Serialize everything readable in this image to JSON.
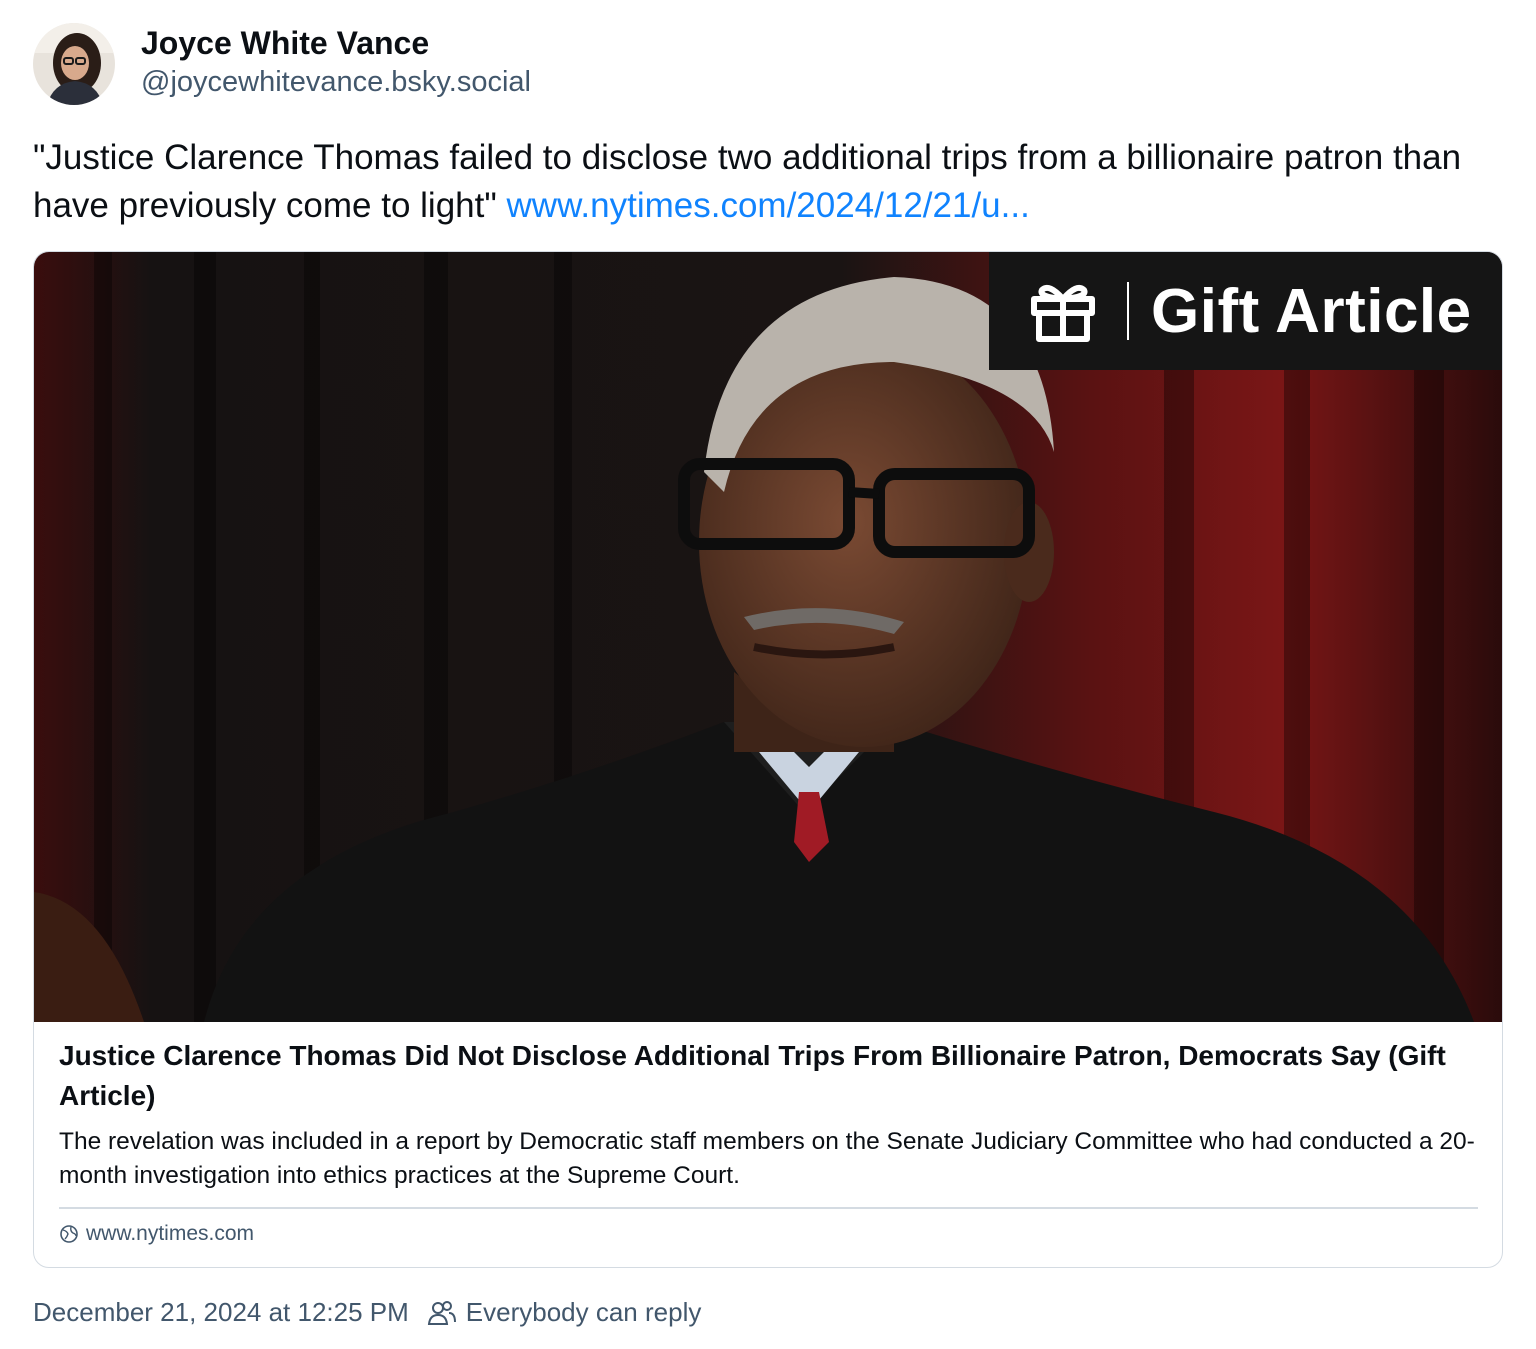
{
  "author": {
    "display_name": "Joyce White Vance",
    "handle": "@joycewhitevance.bsky.social"
  },
  "post": {
    "text": "\"Justice Clarence Thomas failed to disclose two additional trips from a billionaire patron than have previously come to light\"",
    "link_text": "www.nytimes.com/2024/12/21/u..."
  },
  "card": {
    "image_badge_label": "Gift Article",
    "title": "Justice Clarence Thomas Did Not Disclose Additional Trips From Billionaire Patron, Democrats Say (Gift Article)",
    "description": "The revelation was included in a report by Democratic staff members on the Senate Judiciary Committee who had conducted a 20-month investigation into ethics practices at the Supreme Court.",
    "domain": "www.nytimes.com"
  },
  "footer": {
    "timestamp": "December 21, 2024 at 12:25 PM",
    "reply_setting": "Everybody can reply"
  },
  "icons": {
    "gift": "gift-icon",
    "globe": "globe-icon",
    "people": "people-icon"
  },
  "colors": {
    "link": "#1083fe",
    "muted_text": "#42576c",
    "border": "#d4dbe2",
    "badge_bg": "#151515"
  }
}
